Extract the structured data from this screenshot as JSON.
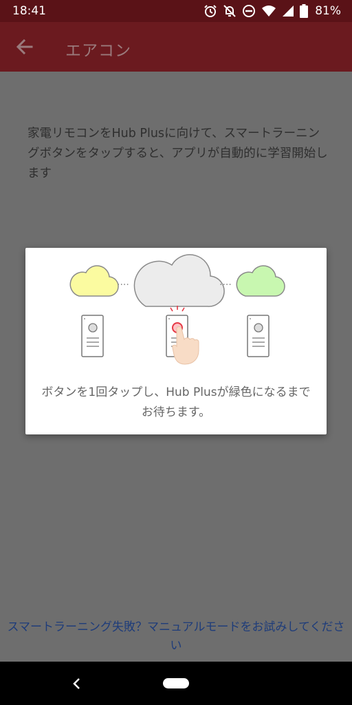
{
  "status_bar": {
    "time": "18:41",
    "battery": "81%",
    "icons": [
      "alarm-icon",
      "bell-off-icon",
      "dnd-icon",
      "wifi-icon",
      "signal-icon",
      "battery-icon"
    ]
  },
  "app_bar": {
    "title": "エアコン",
    "back_icon": "arrow-left-icon"
  },
  "instructions": "家電リモコンをHub Plusに向けて、スマートラーニングボタンをタップすると、アプリが自動的に学習開始します",
  "dialog": {
    "caption": "ボタンを1回タップし、Hub Plusが緑色になるまでお待ちます。"
  },
  "link": {
    "text": "スマートラーニング失敗？マニュアルモードをお試みしてください"
  },
  "colors": {
    "status_bar": "#5a1217",
    "app_bar": "#6b1a1f",
    "overlay": "#6e6e6e",
    "link": "#1e3c7a",
    "cloud_yellow": "#fbfba0",
    "cloud_green": "#c8f7b0",
    "cloud_gray": "#ececec",
    "button_red": "#e53945"
  }
}
